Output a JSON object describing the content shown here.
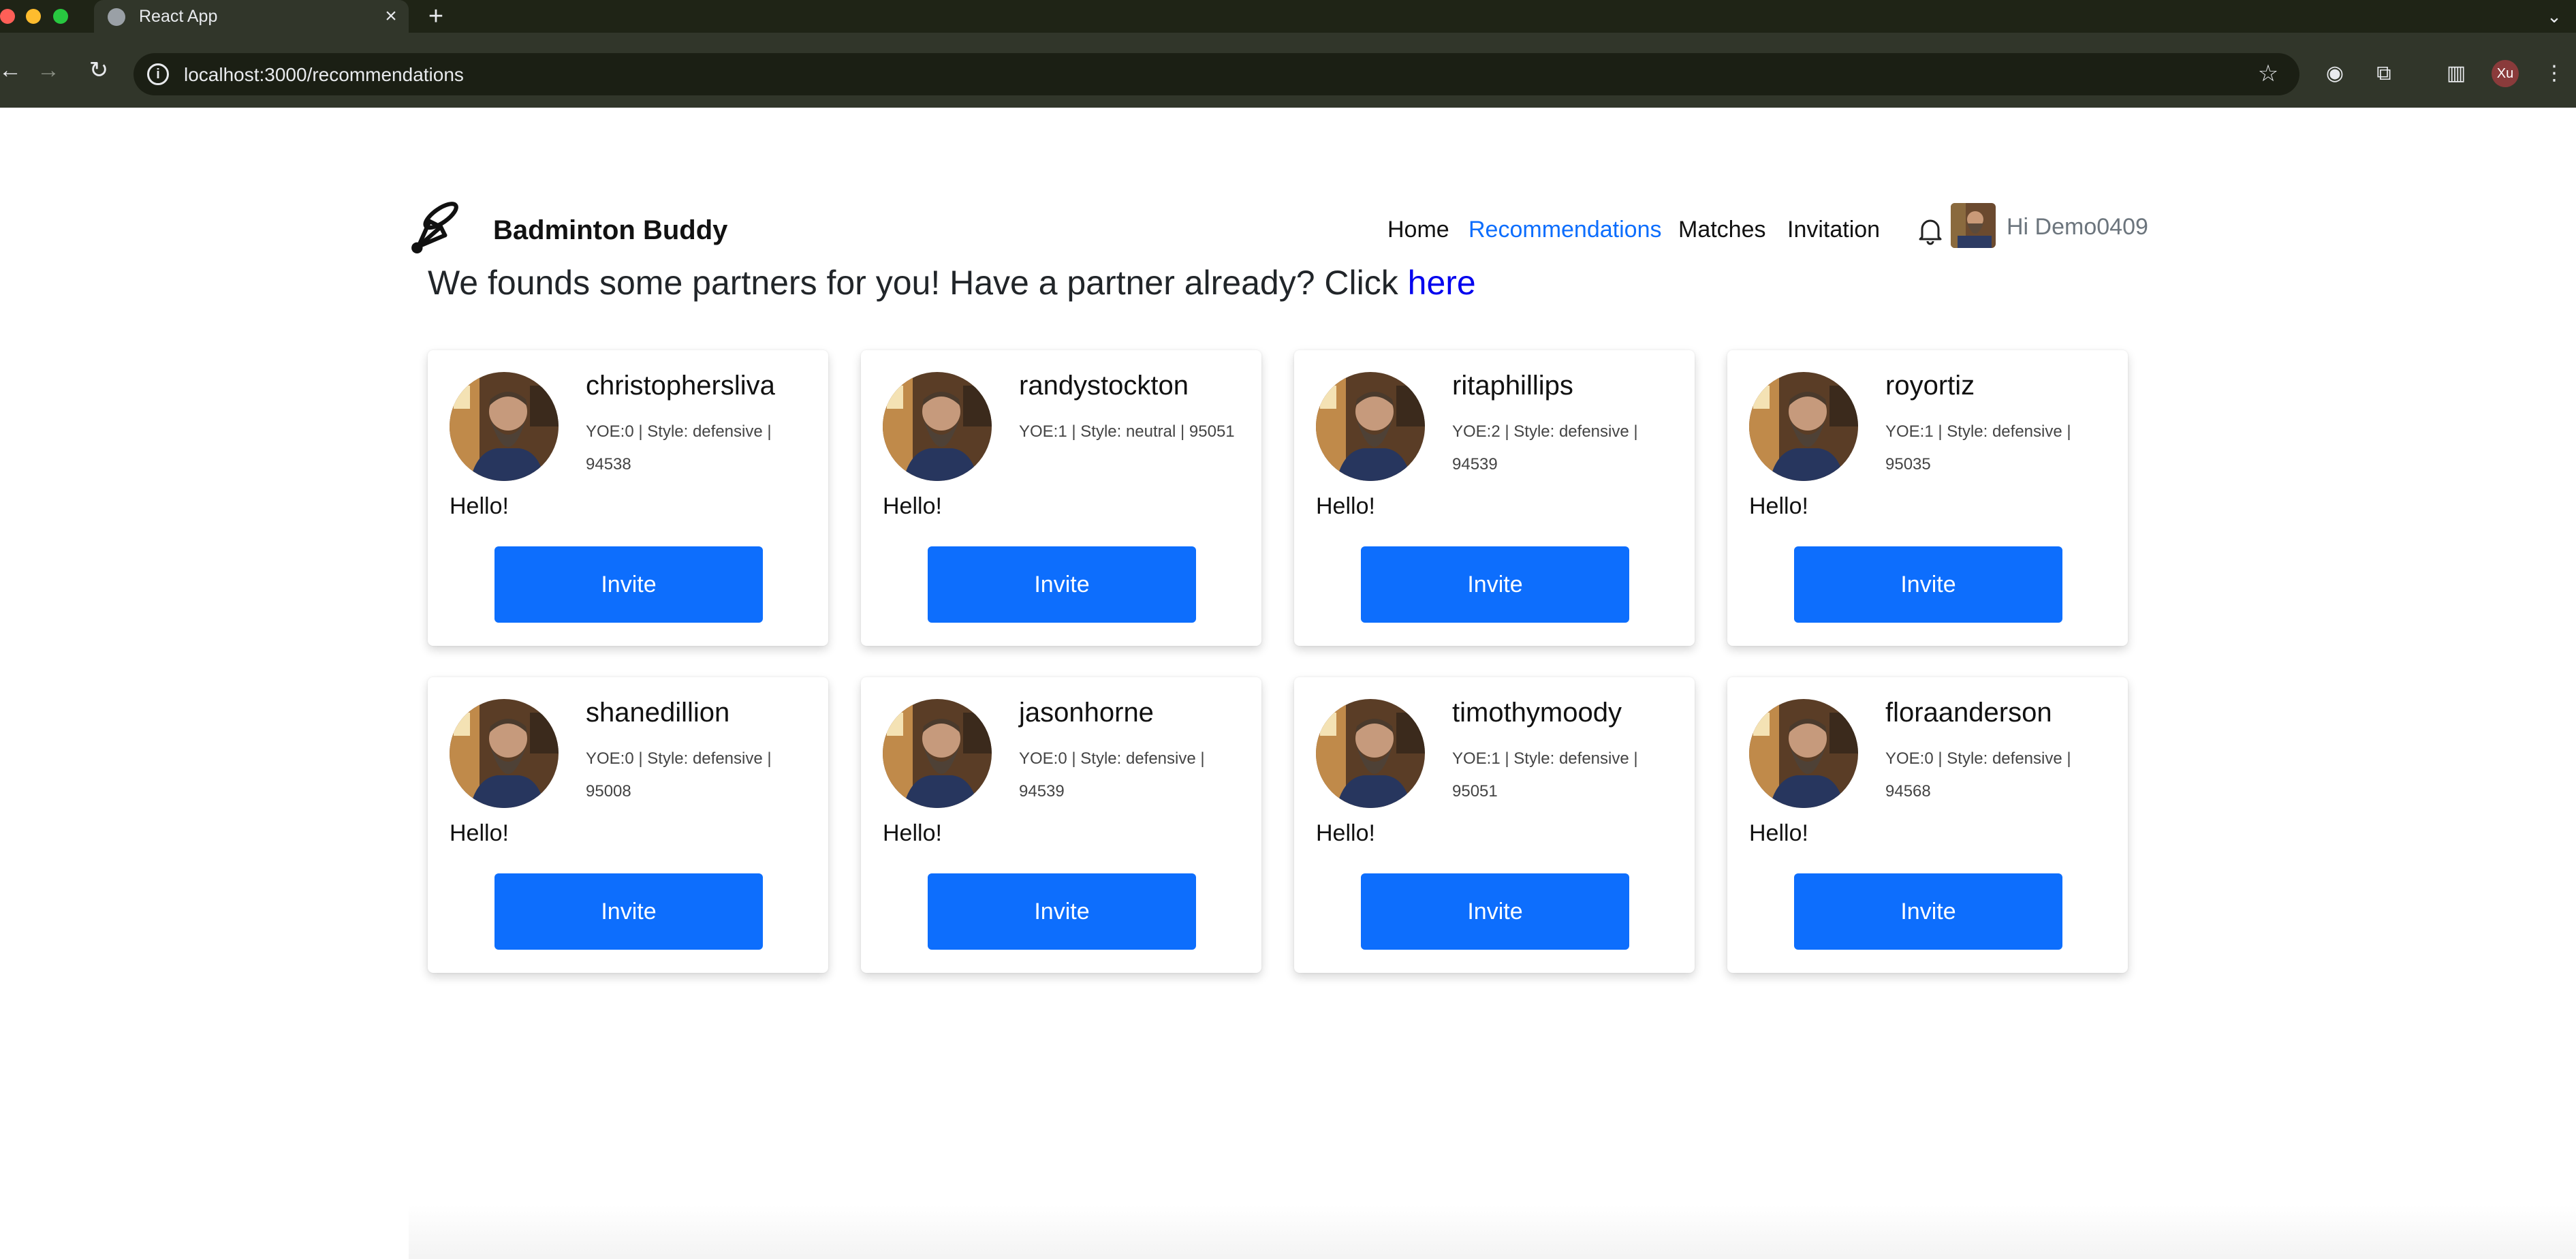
{
  "browser": {
    "tab_title": "React App",
    "url": "localhost:3000/recommendations",
    "profile_initials": "Xu"
  },
  "app": {
    "brand": "Badminton Buddy",
    "nav": {
      "home": "Home",
      "recommendations": "Recommendations",
      "matches": "Matches",
      "invitation": "Invitation"
    },
    "greeting": "Hi Demo0409",
    "active_color": "#0d6efd"
  },
  "intro": {
    "text": "We founds some partners for you! Have a partner already? Click ",
    "link": "here"
  },
  "cards": [
    {
      "username": "christophersliva",
      "meta": "YOE:0 | Style: defensive | 94538",
      "bio": "Hello!",
      "button": "Invite"
    },
    {
      "username": "randystockton",
      "meta": "YOE:1 | Style: neutral | 95051",
      "bio": "Hello!",
      "button": "Invite"
    },
    {
      "username": "ritaphillips",
      "meta": "YOE:2 | Style: defensive | 94539",
      "bio": "Hello!",
      "button": "Invite"
    },
    {
      "username": "royortiz",
      "meta": "YOE:1 | Style: defensive | 95035",
      "bio": "Hello!",
      "button": "Invite"
    },
    {
      "username": "shanedillion",
      "meta": "YOE:0 | Style: defensive | 95008",
      "bio": "Hello!",
      "button": "Invite"
    },
    {
      "username": "jasonhorne",
      "meta": "YOE:0 | Style: defensive | 94539",
      "bio": "Hello!",
      "button": "Invite"
    },
    {
      "username": "timothymoody",
      "meta": "YOE:1 | Style: defensive | 95051",
      "bio": "Hello!",
      "button": "Invite"
    },
    {
      "username": "floraanderson",
      "meta": "YOE:0 | Style: defensive | 94568",
      "bio": "Hello!",
      "button": "Invite"
    }
  ]
}
